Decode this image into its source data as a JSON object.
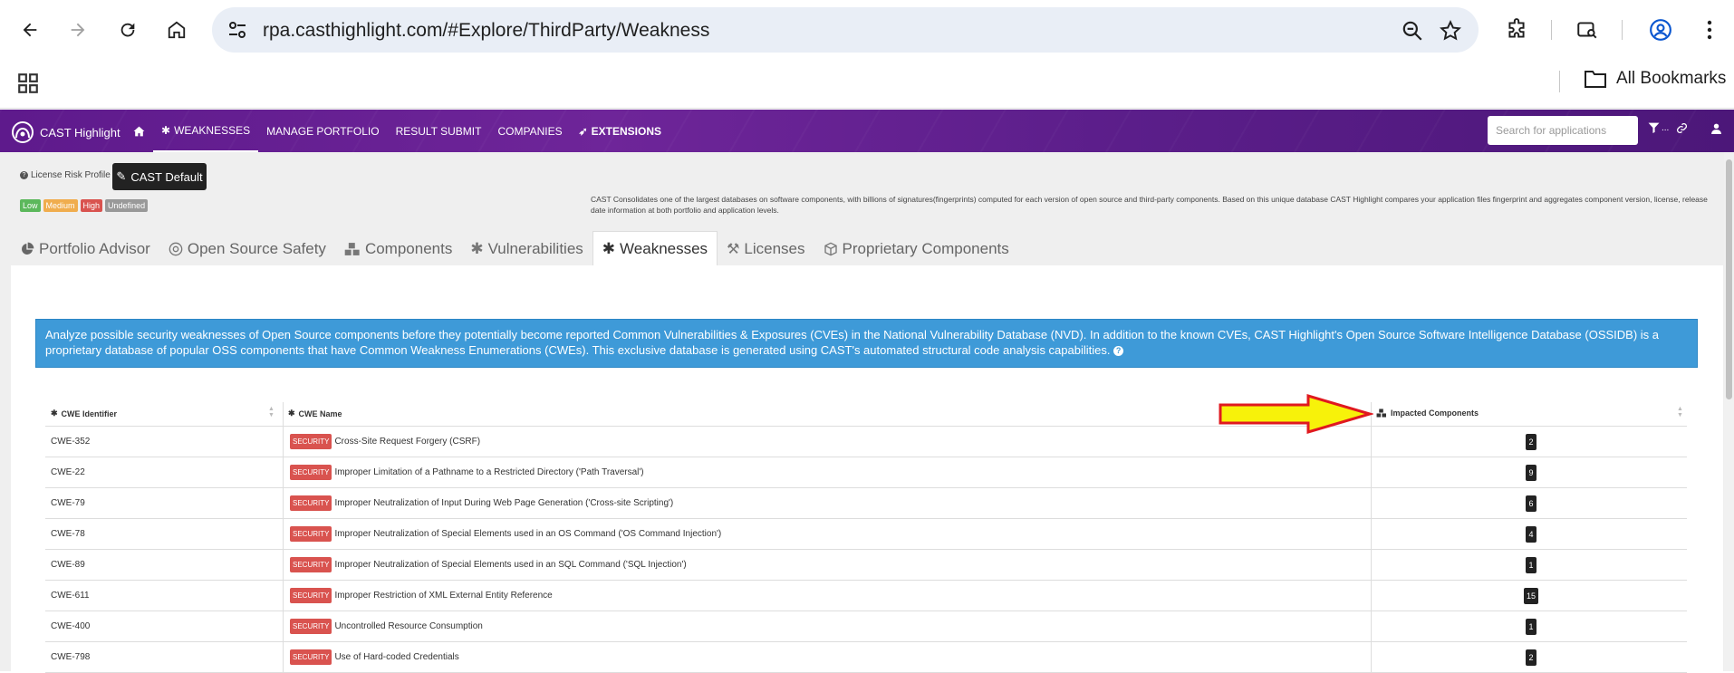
{
  "browser": {
    "url": "rpa.casthighlight.com/#Explore/ThirdParty/Weakness",
    "all_bookmarks": "All Bookmarks"
  },
  "app_nav": {
    "brand": "CAST Highlight",
    "items": [
      {
        "label": "WEAKNESSES",
        "icon": "bug-icon"
      },
      {
        "label": "MANAGE PORTFOLIO"
      },
      {
        "label": "RESULT SUBMIT"
      },
      {
        "label": "COMPANIES"
      },
      {
        "label": "EXTENSIONS",
        "icon": "rocket-icon"
      }
    ],
    "search_placeholder": "Search for applications",
    "filter_label": "..."
  },
  "profile": {
    "label": "License Risk Profile",
    "button": "CAST Default",
    "legend": [
      {
        "label": "Low",
        "color": "#5cb85c"
      },
      {
        "label": "Medium",
        "color": "#f0ad4e"
      },
      {
        "label": "High",
        "color": "#d9534f"
      },
      {
        "label": "Undefined",
        "color": "#999999"
      }
    ],
    "intro": "CAST Consolidates one of the largest databases on software components, with billions of signatures(fingerprints) computed for each version of open source and third-party components. Based on this unique database CAST Highlight compares your application files fingerprint and aggregates component version, license, release date information at both portfolio and application levels."
  },
  "tabs": [
    {
      "label": "Portfolio Advisor",
      "icon": "pie-chart-icon"
    },
    {
      "label": "Open Source Safety",
      "icon": "shield-icon"
    },
    {
      "label": "Components",
      "icon": "cubes-icon"
    },
    {
      "label": "Vulnerabilities",
      "icon": "bug-icon"
    },
    {
      "label": "Weaknesses",
      "icon": "bug-icon",
      "active": true
    },
    {
      "label": "Licenses",
      "icon": "gavel-icon"
    },
    {
      "label": "Proprietary Components",
      "icon": "cube-icon"
    }
  ],
  "info_box": "Analyze possible security weaknesses of Open Source components before they potentially become reported Common Vulnerabilities & Exposures (CVEs) in the National Vulnerability Database (NVD). In addition to the known CVEs, CAST Highlight's Open Source Software Intelligence Database (OSSIDB) is a proprietary database of popular OSS components that have Common Weakness Enumerations (CWEs). This exclusive database is generated using CAST's automated structural code analysis capabilities.",
  "table": {
    "headers": {
      "id": "CWE Identifier",
      "name": "CWE Name",
      "impacted": "Impacted Components"
    },
    "badge": "SECURITY",
    "rows": [
      {
        "id": "CWE-352",
        "name": "Cross-Site Request Forgery (CSRF)",
        "count": "2"
      },
      {
        "id": "CWE-22",
        "name": "Improper Limitation of a Pathname to a Restricted Directory ('Path Traversal')",
        "count": "9"
      },
      {
        "id": "CWE-79",
        "name": "Improper Neutralization of Input During Web Page Generation ('Cross-site Scripting')",
        "count": "6"
      },
      {
        "id": "CWE-78",
        "name": "Improper Neutralization of Special Elements used in an OS Command ('OS Command Injection')",
        "count": "4"
      },
      {
        "id": "CWE-89",
        "name": "Improper Neutralization of Special Elements used in an SQL Command ('SQL Injection')",
        "count": "1"
      },
      {
        "id": "CWE-611",
        "name": "Improper Restriction of XML External Entity Reference",
        "count": "15"
      },
      {
        "id": "CWE-400",
        "name": "Uncontrolled Resource Consumption",
        "count": "1"
      },
      {
        "id": "CWE-798",
        "name": "Use of Hard-coded Credentials",
        "count": "2"
      }
    ]
  }
}
